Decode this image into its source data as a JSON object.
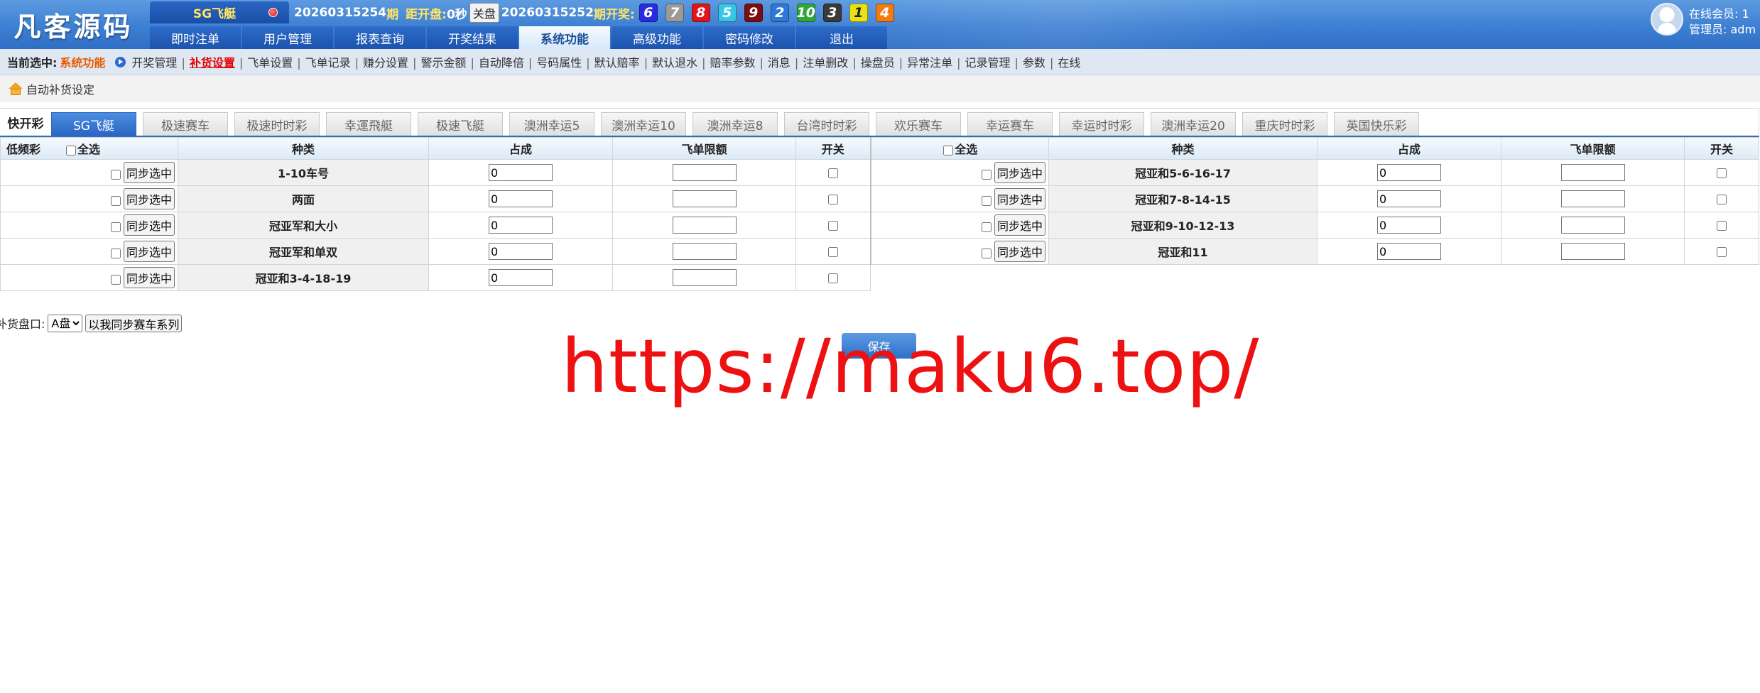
{
  "header": {
    "logo": "凡客源码",
    "game": "SG飞艇",
    "period_current": "20260315254",
    "period_label": "期",
    "countdown_label": "距开盘:",
    "countdown_value": "0秒",
    "close_label": "关盘",
    "period_last": "20260315252",
    "last_label": "期开奖:",
    "balls": [
      {
        "n": "6",
        "color": "#2a2adf"
      },
      {
        "n": "7",
        "color": "#9a9a9a"
      },
      {
        "n": "8",
        "color": "#e0141c"
      },
      {
        "n": "5",
        "color": "#38c6e8"
      },
      {
        "n": "9",
        "color": "#7a0e12"
      },
      {
        "n": "2",
        "color": "#2e78d8"
      },
      {
        "n": "10",
        "color": "#2fa838"
      },
      {
        "n": "3",
        "color": "#3a3a3a"
      },
      {
        "n": "1",
        "color": "#e8e214"
      },
      {
        "n": "4",
        "color": "#f07a14"
      }
    ],
    "online_label": "在线会员: 1",
    "admin_label": "管理员: adm"
  },
  "nav": [
    "即时注单",
    "用户管理",
    "报表查询",
    "开奖结果",
    "系统功能",
    "高级功能",
    "密码修改",
    "退出"
  ],
  "nav_active": 4,
  "submenu": {
    "current_label": "当前选中:",
    "current_value": "系统功能",
    "links": [
      "开奖管理",
      "补货设置",
      "飞单设置",
      "飞单记录",
      "赚分设置",
      "警示金额",
      "自动降倍",
      "号码属性",
      "默认赔率",
      "默认退水",
      "赔率参数",
      "消息",
      "注单删改",
      "操盘员",
      "异常注单",
      "记录管理",
      "参数",
      "在线"
    ],
    "active": 1
  },
  "breadcrumb": "自动补货设定",
  "lottery": {
    "label": "快开彩",
    "tabs": [
      "SG飞艇",
      "极速赛车",
      "极速时时彩",
      "幸運飛艇",
      "极速飞艇",
      "澳洲幸运5",
      "澳洲幸运10",
      "澳洲幸运8",
      "台湾时时彩",
      "欢乐赛车",
      "幸运赛车",
      "幸运时时彩",
      "澳洲幸运20",
      "重庆时时彩",
      "英国快乐彩"
    ],
    "active": 0
  },
  "table": {
    "low_label": "低频彩",
    "select_all": "全选",
    "headers": {
      "kind": "种类",
      "share": "占成",
      "limit": "飞单限额",
      "switch": "开关"
    },
    "sync_label": "同步选中",
    "left": [
      {
        "kind": "1-10车号",
        "share": "0"
      },
      {
        "kind": "两面",
        "share": "0"
      },
      {
        "kind": "冠亚军和大小",
        "share": "0"
      },
      {
        "kind": "冠亚军和单双",
        "share": "0"
      },
      {
        "kind": "冠亚和3-4-18-19",
        "share": "0"
      }
    ],
    "right": [
      {
        "kind": "冠亚和5-6-16-17",
        "share": "0"
      },
      {
        "kind": "冠亚和7-8-14-15",
        "share": "0"
      },
      {
        "kind": "冠亚和9-10-12-13",
        "share": "0"
      },
      {
        "kind": "冠亚和11",
        "share": "0"
      }
    ]
  },
  "bottom": {
    "label": "补货盘口:",
    "options": [
      "A盘"
    ],
    "sync_series": "以我同步赛车系列",
    "save": "保存"
  },
  "watermark": "https://maku6.top/"
}
